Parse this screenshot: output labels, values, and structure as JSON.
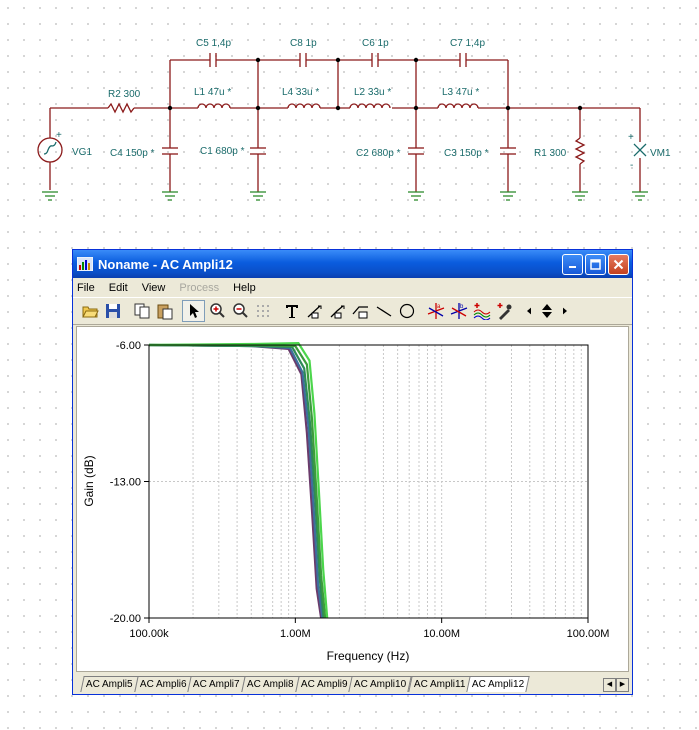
{
  "schematic": {
    "labels": {
      "c5": "C5 1,4p",
      "c8": "C8 1p",
      "c6": "C6 1p",
      "c7": "C7 1,4p",
      "r2": "R2 300",
      "l1": "L1 47u *",
      "l4": "L4 33u *",
      "l2": "L2 33u *",
      "l3": "L3 47u *",
      "vg1": "VG1",
      "c4": "C4 150p *",
      "c1": "C1 680p *",
      "c2": "C2 680p *",
      "c3": "C3 150p *",
      "r1": "R1 300",
      "vm1": "VM1"
    }
  },
  "window": {
    "title": "Noname - AC Ampli12",
    "menu": [
      "File",
      "Edit",
      "View",
      "Process",
      "Help"
    ],
    "menu_disabled": [
      "Process"
    ]
  },
  "toolbar": {
    "icons": [
      "open-icon",
      "save-icon",
      "copy-icon",
      "paste-icon",
      "pointer-icon",
      "zoom-in-icon",
      "zoom-out-icon",
      "grid-icon",
      "text-icon",
      "line-tool-1-icon",
      "line-tool-2-icon",
      "line-tool-3-icon",
      "line-icon",
      "circle-icon",
      "cursor-a-icon",
      "cursor-b-icon",
      "waves-icon",
      "picker-icon"
    ]
  },
  "chart_data": {
    "type": "line",
    "xlabel": "Frequency (Hz)",
    "ylabel": "Gain (dB)",
    "x_scale": "log",
    "xlim": [
      100000,
      100000000
    ],
    "ylim": [
      -20,
      -6
    ],
    "x_ticks": [
      "100.00k",
      "1.00M",
      "10.00M",
      "100.00M"
    ],
    "y_ticks": [
      "-6.00",
      "-13.00",
      "-20.00"
    ],
    "grid": true,
    "series": [
      {
        "color": "#6b3b6b",
        "x": [
          100000,
          500000,
          900000,
          1100000,
          1200000,
          1300000,
          1400000,
          1500000
        ],
        "y": [
          -6.0,
          -6.05,
          -6.2,
          -7.5,
          -10.5,
          -14.5,
          -18.5,
          -20
        ]
      },
      {
        "color": "#3d6f9e",
        "x": [
          100000,
          500000,
          920000,
          1120000,
          1230000,
          1330000,
          1430000,
          1530000
        ],
        "y": [
          -6.0,
          -6.05,
          -6.15,
          -7.4,
          -10.2,
          -14.2,
          -18.3,
          -20
        ]
      },
      {
        "color": "#2e8b57",
        "x": [
          100000,
          500000,
          950000,
          1150000,
          1260000,
          1370000,
          1470000,
          1560000
        ],
        "y": [
          -6.0,
          -6.05,
          -6.1,
          -7.2,
          -10.0,
          -14.0,
          -18.0,
          -20
        ]
      },
      {
        "color": "#3c9c3c",
        "x": [
          100000,
          500000,
          1000000,
          1200000,
          1300000,
          1400000,
          1500000,
          1600000
        ],
        "y": [
          -6.0,
          -6.0,
          -6.05,
          -7.0,
          -9.8,
          -13.8,
          -17.8,
          -20
        ]
      },
      {
        "color": "#4cd64c",
        "x": [
          100000,
          500000,
          1050000,
          1250000,
          1350000,
          1450000,
          1550000,
          1650000
        ],
        "y": [
          -6.0,
          -5.95,
          -5.9,
          -6.8,
          -9.5,
          -13.5,
          -17.5,
          -20
        ]
      }
    ]
  },
  "tabs": [
    "AC Ampli5",
    "AC Ampli6",
    "AC Ampli7",
    "AC Ampli8",
    "AC Ampli9",
    "AC Ampli10",
    "AC Ampli11",
    "AC Ampli12"
  ],
  "active_tab": "AC Ampli12"
}
